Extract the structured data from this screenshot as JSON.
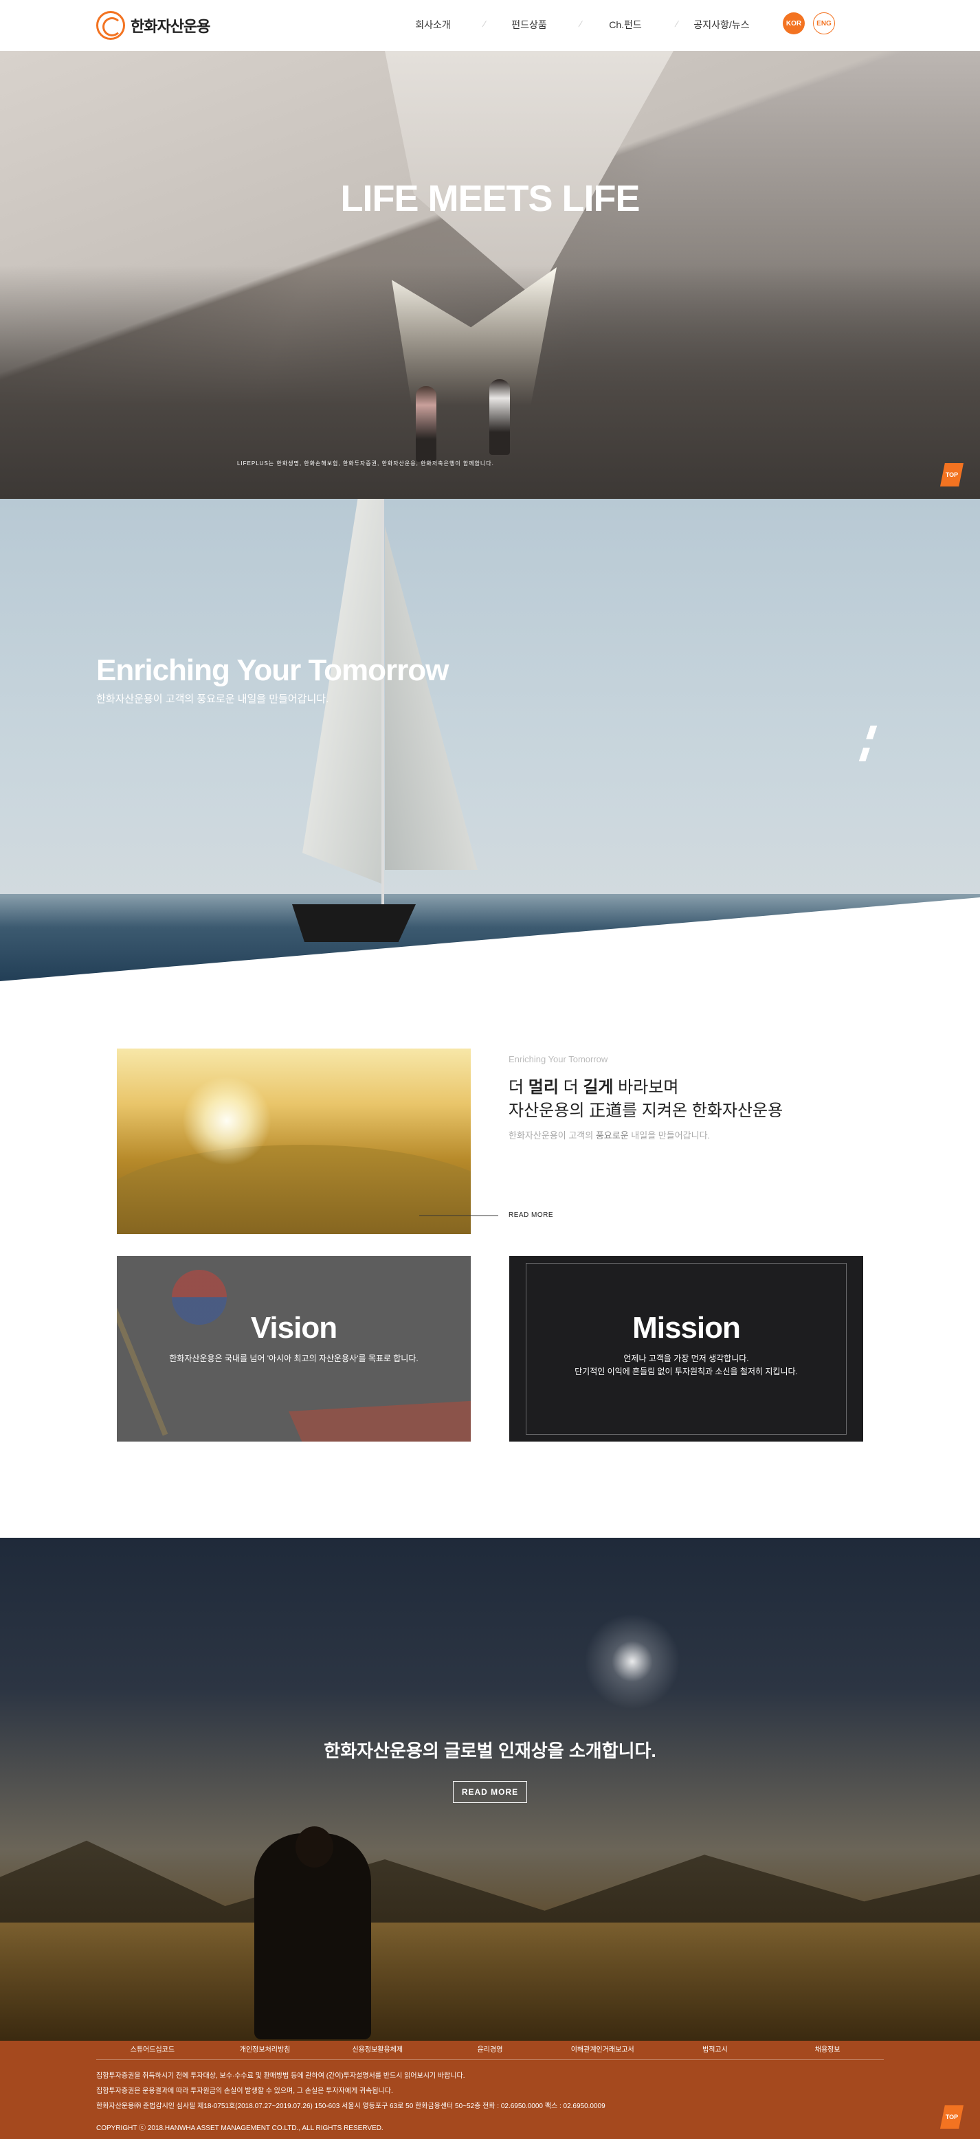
{
  "header": {
    "logo_text": "한화자산운용",
    "nav": [
      "회사소개",
      "펀드상품",
      "Ch.펀드",
      "공지사항/뉴스"
    ],
    "lang_kor": "KOR",
    "lang_eng": "ENG"
  },
  "hero": {
    "title": "LIFE MEETS LIFE",
    "caption": "LIFEPLUS는 한화생명, 한화손해보험, 한화투자증권, 한화자산운용, 한화저축은행이 함께합니다.",
    "top_label": "TOP"
  },
  "sail": {
    "title": "Enriching Your Tomorrow",
    "subtitle": "한화자산운용이 고객의 풍요로운 내일을 만들어갑니다."
  },
  "intro": {
    "label": "Enriching Your Tomorrow",
    "head1_a": "더 ",
    "head1_b": "멀리",
    "head1_c": " 더 ",
    "head1_d": "길게",
    "head1_e": " 바라보며",
    "head2": "자산운용의 正道를 지켜온 한화자산운용",
    "desc_a": "한화자산운용이 고객의 ",
    "desc_b": "풍요로운",
    "desc_c": " 내일을 만들어갑니다.",
    "read_more": "READ MORE"
  },
  "vision": {
    "title": "Vision",
    "text": "한화자산운용은 국내를 넘어 '아시아 최고의 자산운용사'를 목표로 합니다."
  },
  "mission": {
    "title": "Mission",
    "text1": "언제나 고객을 가장 먼저 생각합니다.",
    "text2": "단기적인 이익에 흔들림 없이 투자원칙과 소신을 철저히 지킵니다."
  },
  "people": {
    "title": "한화자산운용의 글로벌 인재상을 소개합니다.",
    "button": "READ MORE"
  },
  "footer": {
    "links": [
      "스튜어드십코드",
      "개인정보처리방침",
      "신용정보활용체제",
      "윤리경영",
      "이해관계인거래보고서",
      "법적고시",
      "채용정보"
    ],
    "line1": "집합투자증권을 취득하시기 전에 투자대상, 보수·수수료 및 환매방법 등에 관하여 (간이)투자설명서를 반드시 읽어보시기 바랍니다.",
    "line2": "집합투자증권은 운용결과에 따라 투자원금의 손실이 발생할 수 있으며, 그 손실은 투자자에게 귀속됩니다.",
    "line3": "한화자산운용㈜ 준법감시인 심사필 제18-0751호(2018.07.27~2019.07.26)  150-603 서울시 영등포구 63로 50 한화금융센터 50~52층 전화 : 02.6950.0000 팩스 : 02.6950.0009",
    "copyright": "COPYRIGHT ⓒ 2018.HANWHA ASSET MANAGEMENT CO.LTD., ALL RIGHTS RESERVED.",
    "top_label": "TOP"
  }
}
